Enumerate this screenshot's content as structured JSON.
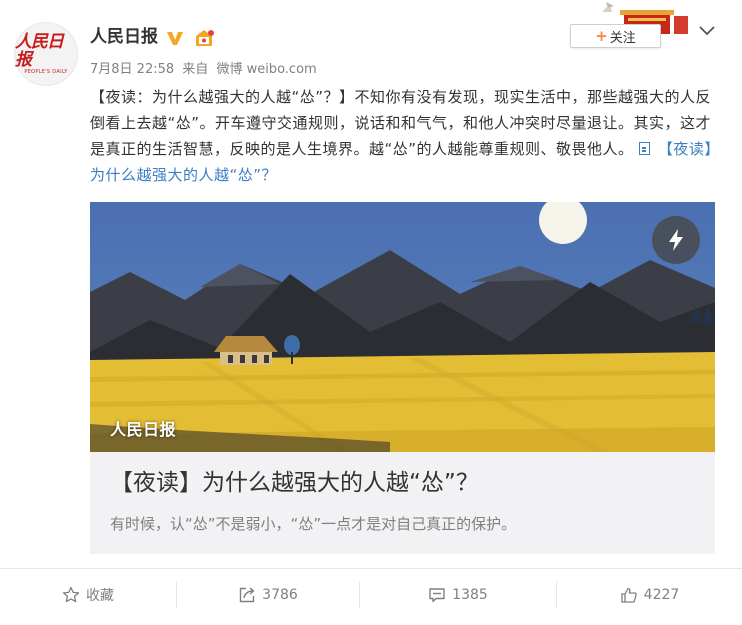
{
  "author": {
    "name": "人民日报",
    "avatar_text": "人民日报",
    "avatar_subtext": "PEOPLE'S DAILY"
  },
  "meta": {
    "date": "7月8日 22:58",
    "source_prefix": "来自",
    "source": "微博 weibo.com"
  },
  "follow_label": "关注",
  "post": {
    "segments": [
      "【夜读：为什么越强大的人越“怂”？】不知你有没有发现，现实生活中，那些越强大的人反倒看上去越“怂”。开车遵守交通规则，说话和和气气，和他人冲突时尽量退让。其实，这才是真正的生活智慧，反映的是人生境界。越“怂”的人越能尊重规则、敬畏他人。"
    ],
    "card_link_text": "【夜读】为什么越强大的人越“怂”？"
  },
  "card": {
    "watermark": "人民日报",
    "title": "【夜读】为什么越强大的人越“怂”？",
    "description": "有时候，认“怂”不是弱小，“怂”一点才是对自己真正的保护。"
  },
  "toolbar": {
    "favorite_label": "收藏",
    "repost_count": "3786",
    "comment_count": "1385",
    "like_count": "4227"
  },
  "colors": {
    "sky": "#4f76b8",
    "mountain": "#3c3f48",
    "field": "#e8c13a",
    "accent": "#ff8140",
    "link": "#3a7fc4"
  }
}
